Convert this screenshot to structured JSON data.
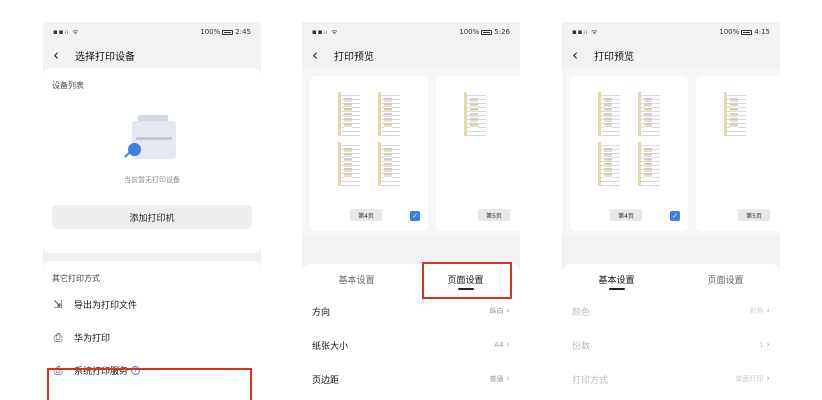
{
  "status": [
    {
      "signal": "▪▪ᵢₗ ᯤ",
      "battery": "100%",
      "time": "2:45"
    },
    {
      "signal": "▪▪ᵢₗ ᯤ",
      "battery": "100%",
      "time": "5:26"
    },
    {
      "signal": "▪▪ᵢₗ ᯤ",
      "battery": "100%",
      "time": "4:15"
    }
  ],
  "screen1": {
    "title": "选择打印设备",
    "device_list_label": "设备列表",
    "empty_text": "当前暂无打印设备",
    "add_printer": "添加打印机",
    "other_label": "其它打印方式",
    "options": [
      {
        "label": "导出为打印文件",
        "icon": "export-icon"
      },
      {
        "label": "华为打印",
        "icon": "printer-icon"
      },
      {
        "label": "系统打印服务",
        "icon": "printer-icon"
      }
    ],
    "help_glyph": "?"
  },
  "screen2": {
    "title": "打印预览",
    "page_labels": [
      "第4页",
      "第5页"
    ],
    "tabs": [
      "基本设置",
      "页面设置"
    ],
    "active_tab": 1,
    "rows": [
      {
        "label": "方向",
        "value": "纵向"
      },
      {
        "label": "纸张大小",
        "value": "A4"
      },
      {
        "label": "页边距",
        "value": "普通"
      }
    ]
  },
  "screen3": {
    "title": "打印预览",
    "page_labels": [
      "第4页",
      "第5页"
    ],
    "tabs": [
      "基本设置",
      "页面设置"
    ],
    "active_tab": 0,
    "rows": [
      {
        "label": "颜色",
        "value": "彩色"
      },
      {
        "label": "份数",
        "value": "1"
      },
      {
        "label": "打印方式",
        "value": "单面打印"
      }
    ]
  },
  "colors": {
    "accent": "#3b7fe0",
    "highlight": "#d9321e"
  }
}
